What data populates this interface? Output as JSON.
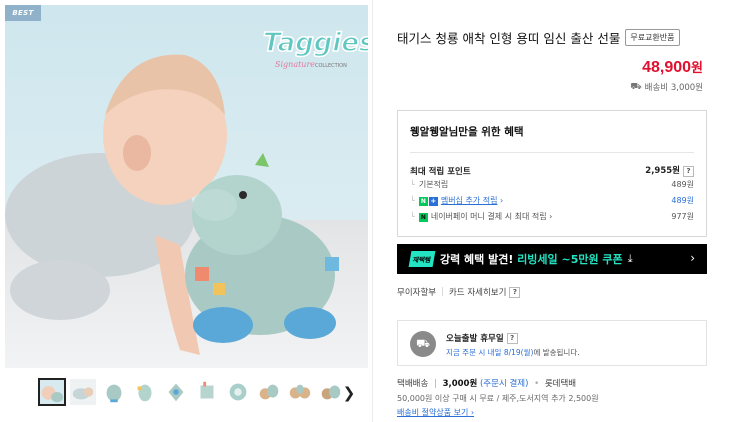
{
  "gallery": {
    "badge": "BEST",
    "logo_text": "Taggies",
    "logo_sub": "Signature COLLECTION",
    "thumbnail_count": 10,
    "next_icon": "chevron-right-icon"
  },
  "product": {
    "title": "태기스 청룡 애착 인형 용띠 임신 출산 선물",
    "free_return": "무료교환반품",
    "price": "48,900",
    "price_unit": "원",
    "shipping_fee": "배송비 3,000원"
  },
  "benefits": {
    "title": "웽알웽알님만을 위한 혜택",
    "max_points_label": "최대 적립 포인트",
    "max_points_value": "2,955원",
    "basic_label": "기본적립",
    "basic_value": "489원",
    "membership_label": "멤버십 추가 적립",
    "membership_value": "489원",
    "npay_label": "네이버페이 머니 결제 시 최대 적립",
    "npay_value": "977원"
  },
  "coupon": {
    "chip": "재택템",
    "text_prefix": "강력 혜택 발견! ",
    "text_highlight": "리빙세일 ~5만원 쿠폰"
  },
  "installment": {
    "label": "무이자할부",
    "detail": "카드 자세히보기"
  },
  "delivery": {
    "title": "오늘출발 휴무일",
    "desc_highlight": "지금 주문 시 내일 8/19(월)",
    "desc_rest": "에 발송됩니다."
  },
  "shipping": {
    "method": "택배배송",
    "fee": "3,000원",
    "pay": "(주문시 결제)",
    "carrier": "롯데택배",
    "note": "50,000원 이상 구매 시 무료 / 제주,도서지역 추가 2,500원",
    "link": "배송비 절약상품 보기"
  },
  "colors": {
    "price": "#e0102e",
    "link": "#2a6fd6",
    "coupon_accent": "#23e5c3",
    "naver_green": "#03c75a"
  }
}
